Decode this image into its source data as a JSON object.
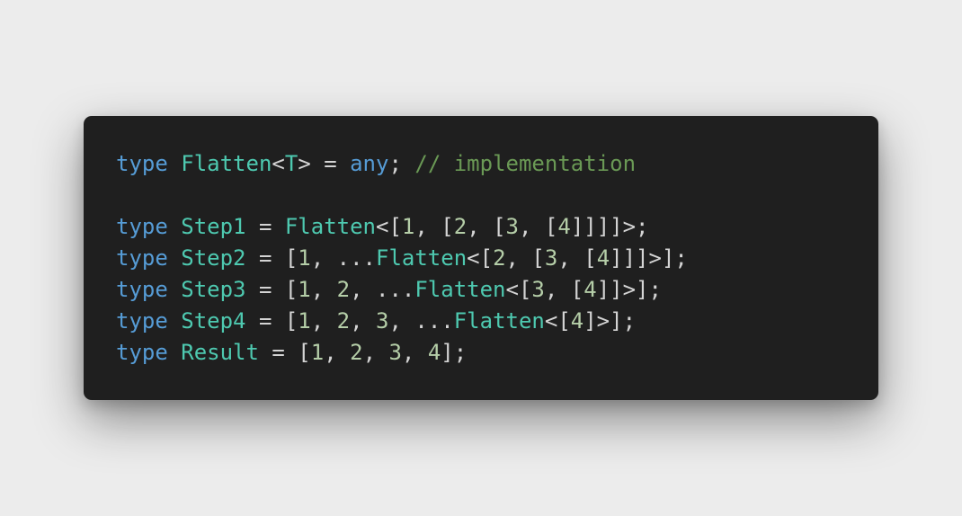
{
  "colors": {
    "page_background": "#ececec",
    "editor_background": "#1f1f1f",
    "keyword": "#569cd6",
    "type_name": "#4ec9b0",
    "number": "#b5cea8",
    "comment": "#6a9955",
    "punctuation": "#d4d4d4"
  },
  "code": {
    "language": "typescript",
    "lines": [
      [
        {
          "t": "type",
          "k": "keyword"
        },
        {
          "t": " ",
          "k": "punctuation"
        },
        {
          "t": "Flatten",
          "k": "type_name"
        },
        {
          "t": "<",
          "k": "punctuation"
        },
        {
          "t": "T",
          "k": "type_name"
        },
        {
          "t": "> = ",
          "k": "punctuation"
        },
        {
          "t": "any",
          "k": "keyword"
        },
        {
          "t": "; ",
          "k": "punctuation"
        },
        {
          "t": "// implementation",
          "k": "comment"
        }
      ],
      [],
      [
        {
          "t": "type",
          "k": "keyword"
        },
        {
          "t": " ",
          "k": "punctuation"
        },
        {
          "t": "Step1",
          "k": "type_name"
        },
        {
          "t": " = ",
          "k": "punctuation"
        },
        {
          "t": "Flatten",
          "k": "type_name"
        },
        {
          "t": "<[",
          "k": "punctuation"
        },
        {
          "t": "1",
          "k": "number"
        },
        {
          "t": ", [",
          "k": "punctuation"
        },
        {
          "t": "2",
          "k": "number"
        },
        {
          "t": ", [",
          "k": "punctuation"
        },
        {
          "t": "3",
          "k": "number"
        },
        {
          "t": ", [",
          "k": "punctuation"
        },
        {
          "t": "4",
          "k": "number"
        },
        {
          "t": "]]]]>;",
          "k": "punctuation"
        }
      ],
      [
        {
          "t": "type",
          "k": "keyword"
        },
        {
          "t": " ",
          "k": "punctuation"
        },
        {
          "t": "Step2",
          "k": "type_name"
        },
        {
          "t": " = [",
          "k": "punctuation"
        },
        {
          "t": "1",
          "k": "number"
        },
        {
          "t": ", ...",
          "k": "punctuation"
        },
        {
          "t": "Flatten",
          "k": "type_name"
        },
        {
          "t": "<[",
          "k": "punctuation"
        },
        {
          "t": "2",
          "k": "number"
        },
        {
          "t": ", [",
          "k": "punctuation"
        },
        {
          "t": "3",
          "k": "number"
        },
        {
          "t": ", [",
          "k": "punctuation"
        },
        {
          "t": "4",
          "k": "number"
        },
        {
          "t": "]]]>];",
          "k": "punctuation"
        }
      ],
      [
        {
          "t": "type",
          "k": "keyword"
        },
        {
          "t": " ",
          "k": "punctuation"
        },
        {
          "t": "Step3",
          "k": "type_name"
        },
        {
          "t": " = [",
          "k": "punctuation"
        },
        {
          "t": "1",
          "k": "number"
        },
        {
          "t": ", ",
          "k": "punctuation"
        },
        {
          "t": "2",
          "k": "number"
        },
        {
          "t": ", ...",
          "k": "punctuation"
        },
        {
          "t": "Flatten",
          "k": "type_name"
        },
        {
          "t": "<[",
          "k": "punctuation"
        },
        {
          "t": "3",
          "k": "number"
        },
        {
          "t": ", [",
          "k": "punctuation"
        },
        {
          "t": "4",
          "k": "number"
        },
        {
          "t": "]]>];",
          "k": "punctuation"
        }
      ],
      [
        {
          "t": "type",
          "k": "keyword"
        },
        {
          "t": " ",
          "k": "punctuation"
        },
        {
          "t": "Step4",
          "k": "type_name"
        },
        {
          "t": " = [",
          "k": "punctuation"
        },
        {
          "t": "1",
          "k": "number"
        },
        {
          "t": ", ",
          "k": "punctuation"
        },
        {
          "t": "2",
          "k": "number"
        },
        {
          "t": ", ",
          "k": "punctuation"
        },
        {
          "t": "3",
          "k": "number"
        },
        {
          "t": ", ...",
          "k": "punctuation"
        },
        {
          "t": "Flatten",
          "k": "type_name"
        },
        {
          "t": "<[",
          "k": "punctuation"
        },
        {
          "t": "4",
          "k": "number"
        },
        {
          "t": "]>];",
          "k": "punctuation"
        }
      ],
      [
        {
          "t": "type",
          "k": "keyword"
        },
        {
          "t": " ",
          "k": "punctuation"
        },
        {
          "t": "Result",
          "k": "type_name"
        },
        {
          "t": " = [",
          "k": "punctuation"
        },
        {
          "t": "1",
          "k": "number"
        },
        {
          "t": ", ",
          "k": "punctuation"
        },
        {
          "t": "2",
          "k": "number"
        },
        {
          "t": ", ",
          "k": "punctuation"
        },
        {
          "t": "3",
          "k": "number"
        },
        {
          "t": ", ",
          "k": "punctuation"
        },
        {
          "t": "4",
          "k": "number"
        },
        {
          "t": "];",
          "k": "punctuation"
        }
      ]
    ]
  }
}
